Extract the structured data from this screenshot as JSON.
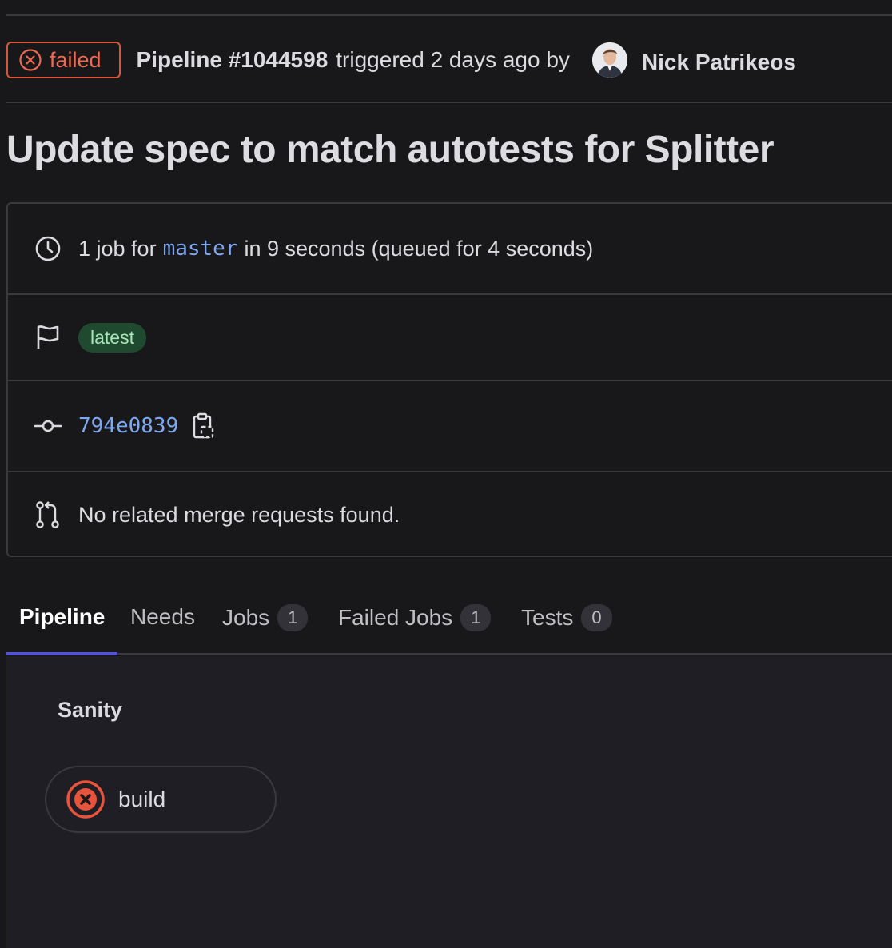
{
  "header": {
    "status": "failed",
    "pipeline_id": "Pipeline #1044598",
    "triggered_text": "triggered 2 days ago by",
    "user_name": "Nick Patrikeos"
  },
  "title": "Update spec to match autotests for Splitter",
  "info": {
    "duration_prefix": "1 job for",
    "branch": "master",
    "duration_suffix": "in 9 seconds (queued for 4 seconds)",
    "tag": "latest",
    "commit_sha": "794e0839",
    "merge_requests": "No related merge requests found."
  },
  "tabs": [
    {
      "label": "Pipeline",
      "count": null
    },
    {
      "label": "Needs",
      "count": null
    },
    {
      "label": "Jobs",
      "count": "1"
    },
    {
      "label": "Failed Jobs",
      "count": "1"
    },
    {
      "label": "Tests",
      "count": "0"
    }
  ],
  "graph": {
    "stage": "Sanity",
    "job": "build",
    "job_status": "failed"
  },
  "colors": {
    "failed": "#d9553a",
    "link": "#7ea8f0",
    "tab_active_underline": "#5454d0",
    "tag_bg": "#1f4a2f"
  },
  "icons": [
    "status-failed-icon",
    "clock-icon",
    "flag-icon",
    "commit-icon",
    "copy-clipboard-icon",
    "merge-request-icon",
    "job-failed-icon"
  ]
}
